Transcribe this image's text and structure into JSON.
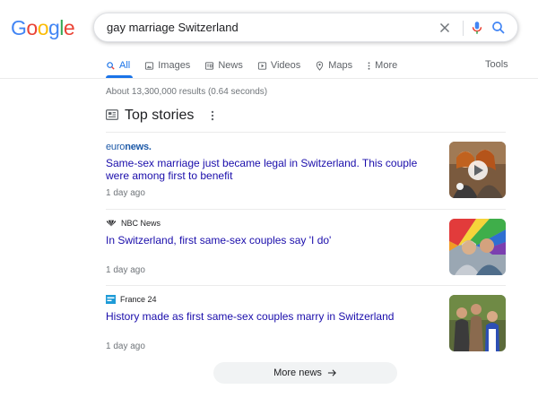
{
  "logo": {
    "text": "Google",
    "letters": [
      "G",
      "o",
      "o",
      "g",
      "l",
      "e"
    ],
    "colors": [
      "#4285f4",
      "#ea4335",
      "#fbbc05",
      "#4285f4",
      "#34a853",
      "#ea4335"
    ]
  },
  "search": {
    "query": "gay marriage Switzerland"
  },
  "tabs": [
    {
      "label": "All",
      "icon": "search-icon",
      "active": true
    },
    {
      "label": "Images",
      "icon": "image-icon"
    },
    {
      "label": "News",
      "icon": "news-icon"
    },
    {
      "label": "Videos",
      "icon": "video-icon"
    },
    {
      "label": "Maps",
      "icon": "map-pin-icon"
    },
    {
      "label": "More",
      "icon": "more-dots-icon"
    }
  ],
  "tools_label": "Tools",
  "result_stats": "About 13,300,000 results (0.64 seconds)",
  "top_stories": {
    "title": "Top stories",
    "stories": [
      {
        "source": "euronews.",
        "source_icon": "euronews-logo",
        "headline": "Same-sex marriage just became legal in Switzerland. This couple were among first to benefit",
        "age": "1 day ago",
        "thumbnail": "video-thumbnail-couple"
      },
      {
        "source": "NBC News",
        "source_icon": "nbc-peacock-icon",
        "headline": "In Switzerland, first same-sex couples say 'I do'",
        "age": "1 day ago",
        "thumbnail": "photo-couple-rainbow-flag"
      },
      {
        "source": "France 24",
        "source_icon": "france24-icon",
        "headline": "History made as first same-sex couples marry in Switzerland",
        "age": "1 day ago",
        "thumbnail": "photo-wedding-crowd"
      }
    ]
  },
  "more_news_label": "More news",
  "colors": {
    "link": "#1a0dab",
    "accent": "#1a73e8",
    "meta": "#70757a"
  }
}
